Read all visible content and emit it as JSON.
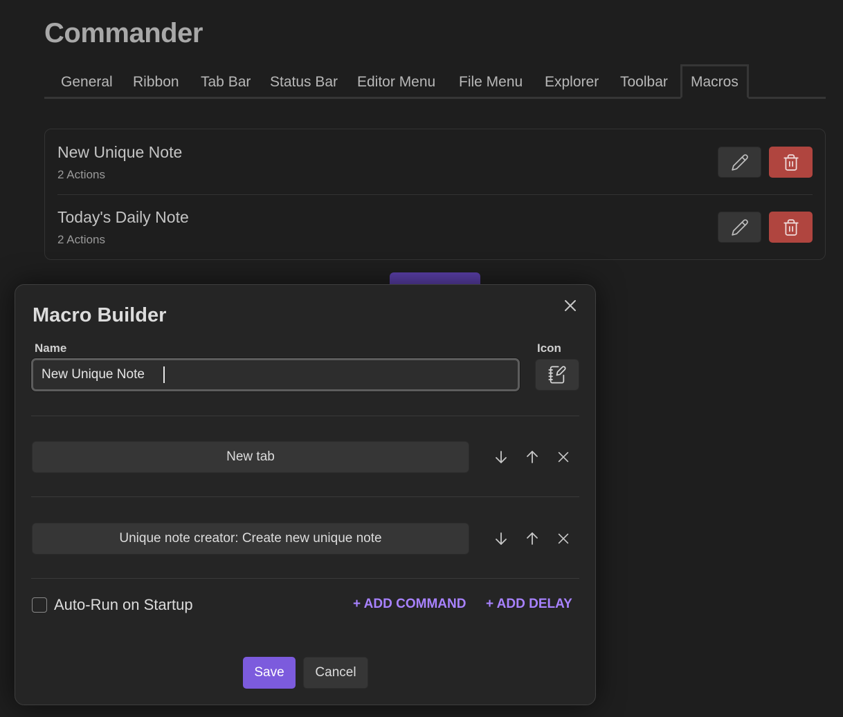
{
  "page": {
    "title": "Commander"
  },
  "tabs": [
    {
      "label": "General"
    },
    {
      "label": "Ribbon"
    },
    {
      "label": "Tab Bar"
    },
    {
      "label": "Status Bar"
    },
    {
      "label": "Editor Menu"
    },
    {
      "label": "File Menu"
    },
    {
      "label": "Explorer"
    },
    {
      "label": "Toolbar"
    },
    {
      "label": "Macros",
      "active": true
    }
  ],
  "macros": [
    {
      "name": "New Unique Note",
      "meta": "2 Actions"
    },
    {
      "name": "Today's Daily Note",
      "meta": "2 Actions"
    }
  ],
  "modal": {
    "title": "Macro Builder",
    "name_label": "Name",
    "icon_label": "Icon",
    "name_value": "New Unique Note",
    "icon": "notebook-pen-icon",
    "actions": [
      {
        "label": "New tab"
      },
      {
        "label": "Unique note creator: Create new unique note"
      }
    ],
    "auto_run_label": "Auto-Run on Startup",
    "auto_run_checked": false,
    "add_command_label": "+ ADD COMMAND",
    "add_delay_label": "+ ADD DELAY",
    "save_label": "Save",
    "cancel_label": "Cancel"
  },
  "colors": {
    "accent": "#7c5bdd",
    "link": "#a882ff",
    "danger": "#b0453f",
    "background": "#1e1e1e",
    "modal_background": "#252525"
  }
}
